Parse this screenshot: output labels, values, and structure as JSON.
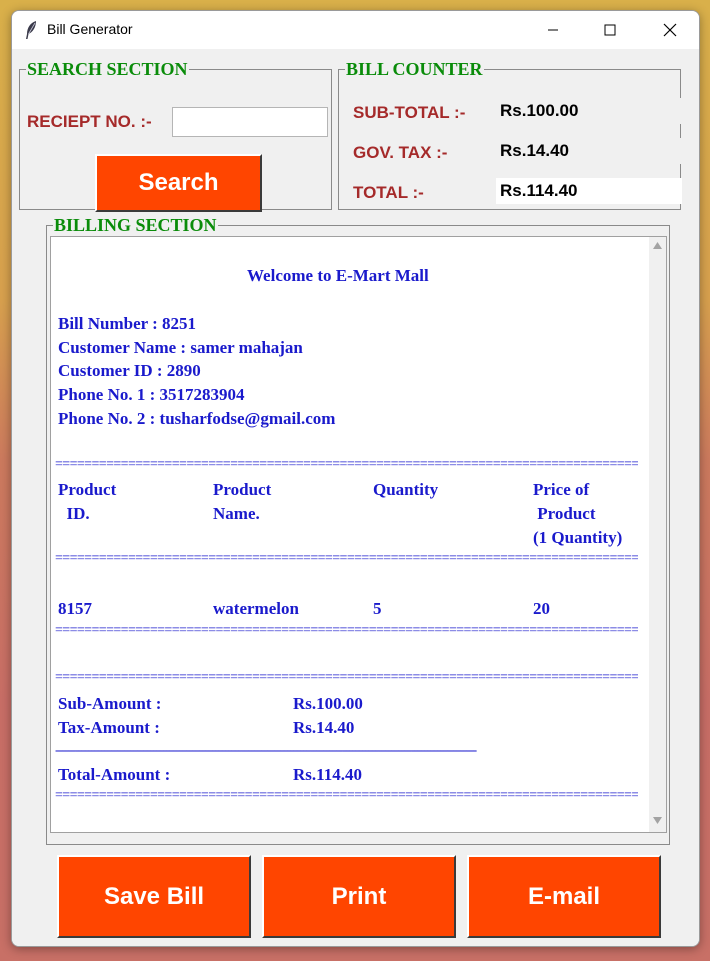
{
  "window": {
    "title": "Bill Generator",
    "icon": "feather-icon"
  },
  "search_section": {
    "legend": "SEARCH SECTION",
    "receipt_label": "RECIEPT NO. :-",
    "receipt_value": "",
    "search_button": "Search"
  },
  "bill_counter": {
    "legend": "BILL COUNTER",
    "subtotal_label": "SUB-TOTAL :-",
    "subtotal_value": "Rs.100.00",
    "tax_label": "GOV. TAX :-",
    "tax_value": "Rs.14.40",
    "total_label": "TOTAL :-",
    "total_value": "Rs.114.40"
  },
  "billing_section": {
    "legend": "BILLING SECTION",
    "welcome": "Welcome to E-Mart Mall",
    "bill_number": "Bill Number : 8251",
    "customer_name": "Customer Name : samer mahajan",
    "customer_id": "Customer ID : 2890",
    "phone1": "Phone No. 1 : 3517283904",
    "phone2": "Phone No. 2 : tusharfodse@gmail.com",
    "separator": "==================================================================================",
    "dash_separator": "---------------------------------------------------------------------------------------------------------------------------------",
    "headers": {
      "product_id_1": "Product",
      "product_id_2": "  ID.",
      "product_name_1": "Product",
      "product_name_2": "Name.",
      "quantity": "Quantity",
      "price_1": "Price of",
      "price_2": " Product",
      "price_3": "(1 Quantity)"
    },
    "items": [
      {
        "id": "8157",
        "name": "watermelon",
        "quantity": "5",
        "price": "20"
      }
    ],
    "sub_amount_label": "Sub-Amount :",
    "sub_amount_value": "Rs.100.00",
    "tax_amount_label": "Tax-Amount :",
    "tax_amount_value": "Rs.14.40",
    "total_amount_label": "Total-Amount :",
    "total_amount_value": "Rs.114.40"
  },
  "actions": {
    "save": "Save Bill",
    "print": "Print",
    "email": "E-mail"
  },
  "colors": {
    "accent_button": "#ff4500",
    "legend_green": "#0a8c0a",
    "label_red": "#a52a2a",
    "bill_text_blue": "#1a1acc"
  }
}
